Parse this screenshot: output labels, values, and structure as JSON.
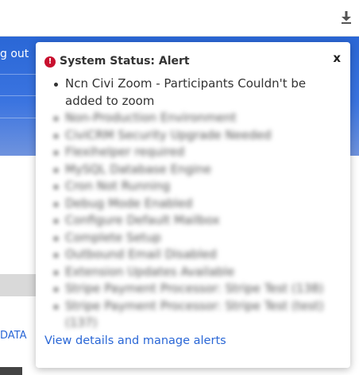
{
  "header": {
    "download_icon": "download-icon"
  },
  "background": {
    "logout_text": "g out",
    "data_link_text": "DATA",
    "brand_color": "#2a67d6"
  },
  "alert_popover": {
    "title": "System Status: Alert",
    "close_label": "x",
    "alert_icon": "alert-circle-icon",
    "alert_color": "#c8102e",
    "items": [
      "Ncn Civi Zoom - Participants Couldn't be added to zoom",
      "Non-Production Environment",
      "CiviCRM Security Upgrade Needed",
      "Flexihelper required",
      "MySQL Database Engine",
      "Cron Not Running",
      "Debug Mode Enabled",
      "Configure Default Mailbox",
      "Complete Setup",
      "Outbound Email Disabled",
      "Extension Updates Available",
      "Stripe Payment Processor: Stripe Test (138)",
      "Stripe Payment Processor: Stripe Test (test) (137)"
    ],
    "view_link": "View details and manage alerts"
  }
}
